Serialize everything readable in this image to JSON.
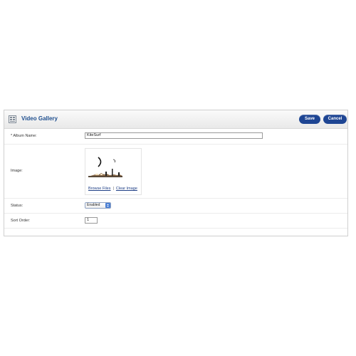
{
  "header": {
    "title": "Video Gallery",
    "save_label": "Save",
    "cancel_label": "Cancel",
    "icon": "gallery-icon"
  },
  "form": {
    "album_name": {
      "label": "* Album Name:",
      "value": "KiteSurf"
    },
    "image": {
      "label": "Image:",
      "browse_label": "Browse Files",
      "separator": "|",
      "clear_label": "Clear Image"
    },
    "status": {
      "label": "Status:",
      "selected": "Enabled"
    },
    "sort_order": {
      "label": "Sort Order:",
      "value": "1"
    }
  },
  "colors": {
    "button": "#1e4593",
    "title": "#1f4f8f",
    "link": "#1f3f86"
  }
}
